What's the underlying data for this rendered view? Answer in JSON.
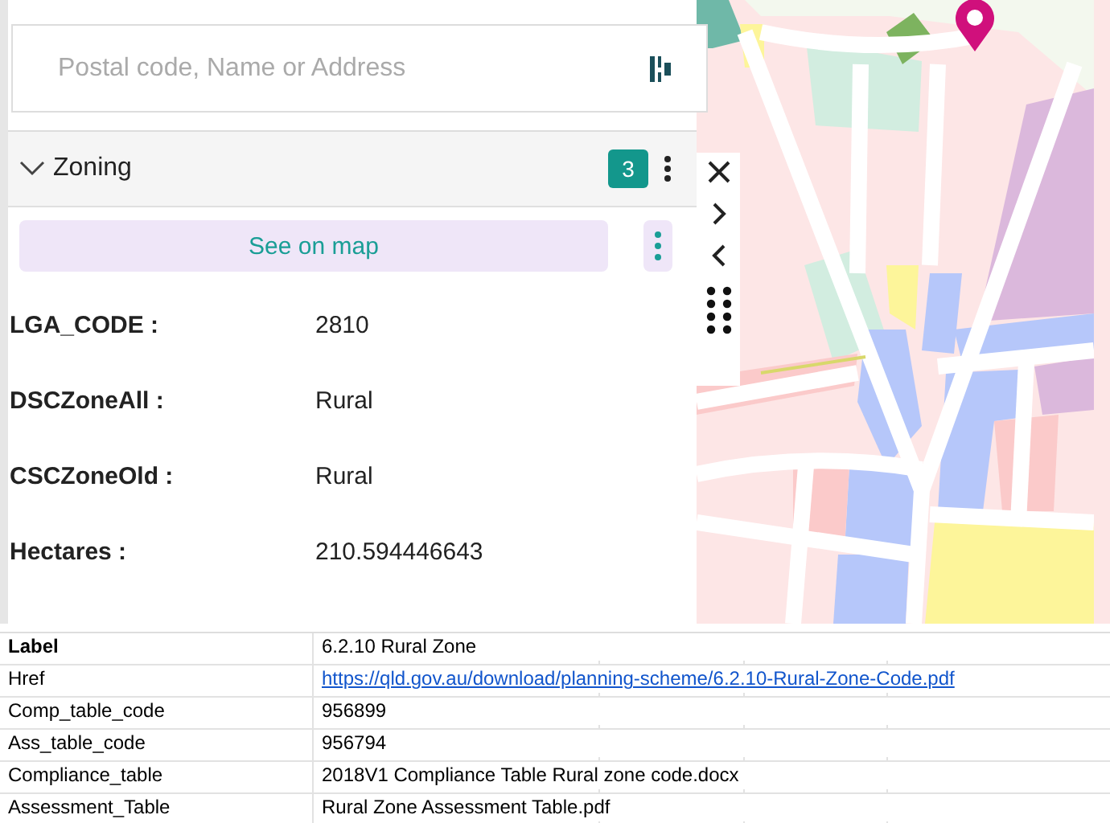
{
  "search": {
    "placeholder": "Postal code, Name or Address"
  },
  "section": {
    "title": "Zoning",
    "expanded": true,
    "count": "3"
  },
  "see_on_map": "See on map",
  "fields": [
    {
      "label": "LGA_CODE :",
      "value": "2810"
    },
    {
      "label": "DSCZoneAll :",
      "value": "Rural"
    },
    {
      "label": "CSCZoneOld :",
      "value": "Rural"
    },
    {
      "label": "Hectares :",
      "value": "210.594446643"
    }
  ],
  "sheet": {
    "rows": [
      {
        "kind": "bold",
        "key": "Label",
        "value": "6.2.10 Rural Zone"
      },
      {
        "kind": "link",
        "key": "Href",
        "value": "https://qld.gov.au/download/planning-scheme/6.2.10-Rural-Zone-Code.pdf"
      },
      {
        "kind": "text",
        "key": "Comp_table_code",
        "value": "956899"
      },
      {
        "kind": "text",
        "key": "Ass_table_code",
        "value": "956794"
      },
      {
        "kind": "text",
        "key": "Compliance_table",
        "value": "2018V1 Compliance Table Rural zone code.docx"
      },
      {
        "kind": "text",
        "key": "Assessment_Table",
        "value": "Rural Zone Assessment Table.pdf"
      }
    ]
  }
}
